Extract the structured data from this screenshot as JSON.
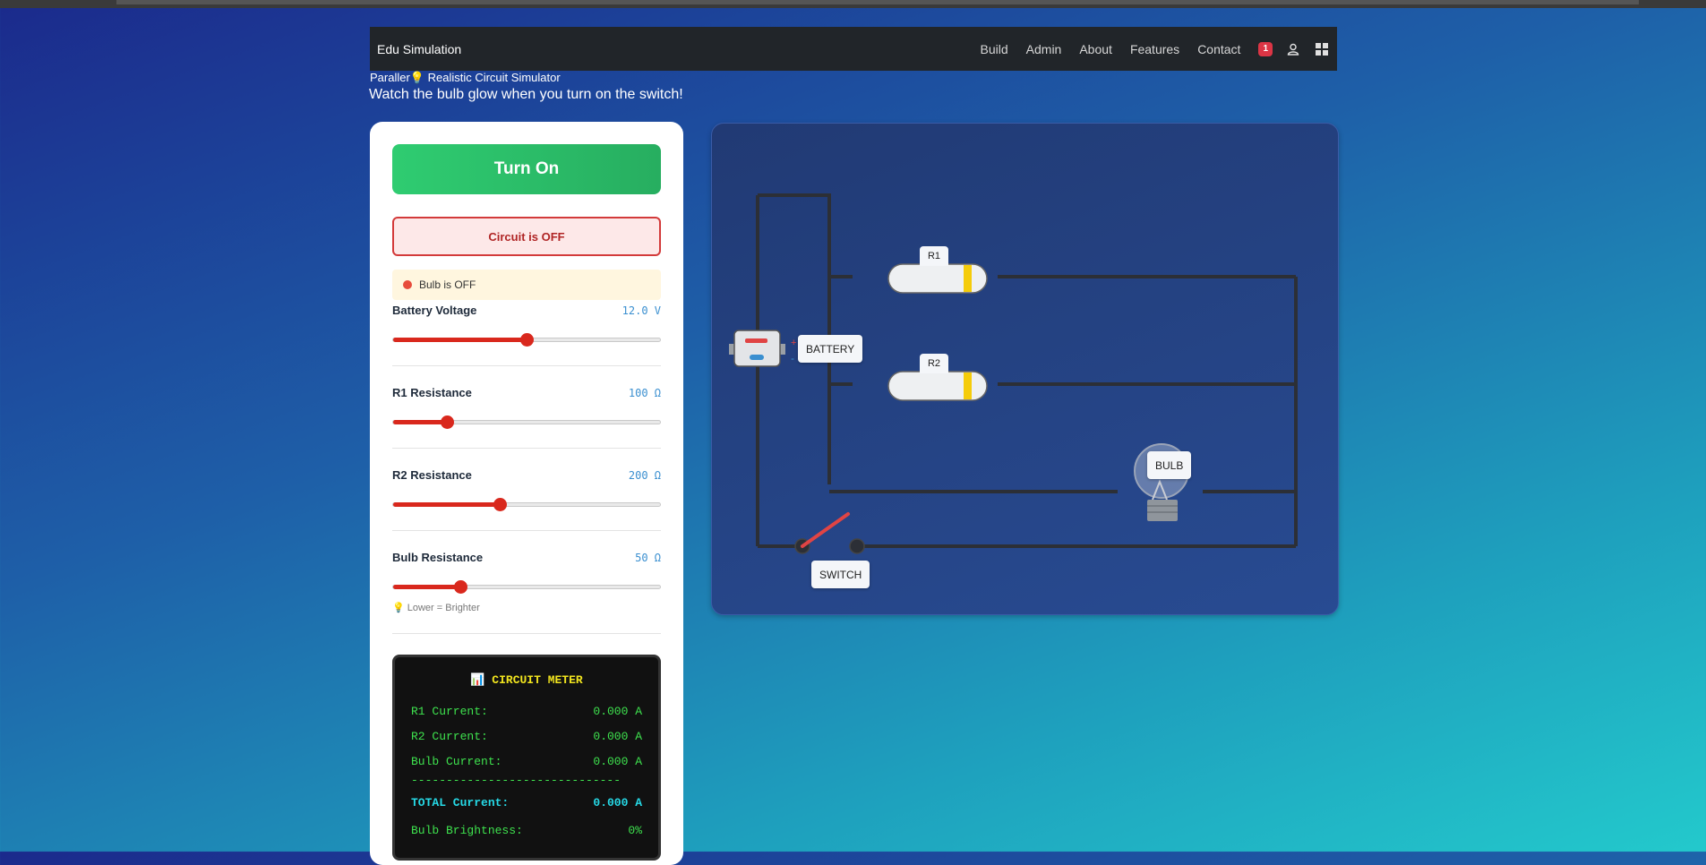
{
  "nav": {
    "brand": "Edu Simulation",
    "links": [
      "Build",
      "Admin",
      "About",
      "Features",
      "Contact"
    ],
    "notification_count": "1",
    "icons": [
      "user-icon",
      "grid-icon"
    ]
  },
  "header": {
    "title": "Paraller💡 Realistic Circuit Simulator",
    "subtitle": "Watch the bulb glow when you turn on the switch!"
  },
  "controls": {
    "toggle_label": "Turn On",
    "circuit_status": "Circuit is OFF",
    "bulb_status": "Bulb is OFF",
    "sliders": [
      {
        "label": "Battery Voltage",
        "value": "12.0 V",
        "level": 0.5
      },
      {
        "label": "R1 Resistance",
        "value": "100 Ω",
        "level": 0.2
      },
      {
        "label": "R2 Resistance",
        "value": "200 Ω",
        "level": 0.4
      },
      {
        "label": "Bulb Resistance",
        "value": "50 Ω",
        "level": 0.25
      }
    ],
    "hint": "💡 Lower = Brighter"
  },
  "meter": {
    "title": "📊 CIRCUIT METER",
    "rows": [
      {
        "label": "R1 Current:",
        "value": "0.000 A"
      },
      {
        "label": "R2 Current:",
        "value": "0.000 A"
      },
      {
        "label": "Bulb Current:",
        "value": "0.000 A"
      }
    ],
    "separator": "------------------------------",
    "total_label": "TOTAL Current:",
    "total_value": "0.000 A",
    "brightness_label": "Bulb Brightness:",
    "brightness_value": "0%"
  },
  "circuit": {
    "battery_label": "BATTERY",
    "r1_label": "R1",
    "r2_label": "R2",
    "bulb_label": "BULB",
    "switch_label": "SWITCH",
    "plus_sign": "+",
    "minus_sign": "-"
  },
  "colors": {
    "accent_green": "#2fcc71",
    "slider_red": "#d9281d",
    "status_red": "#d33a3a",
    "meter_green": "#3ee24e",
    "meter_yellow": "#f2e51e",
    "meter_cyan": "#26d9e6"
  }
}
